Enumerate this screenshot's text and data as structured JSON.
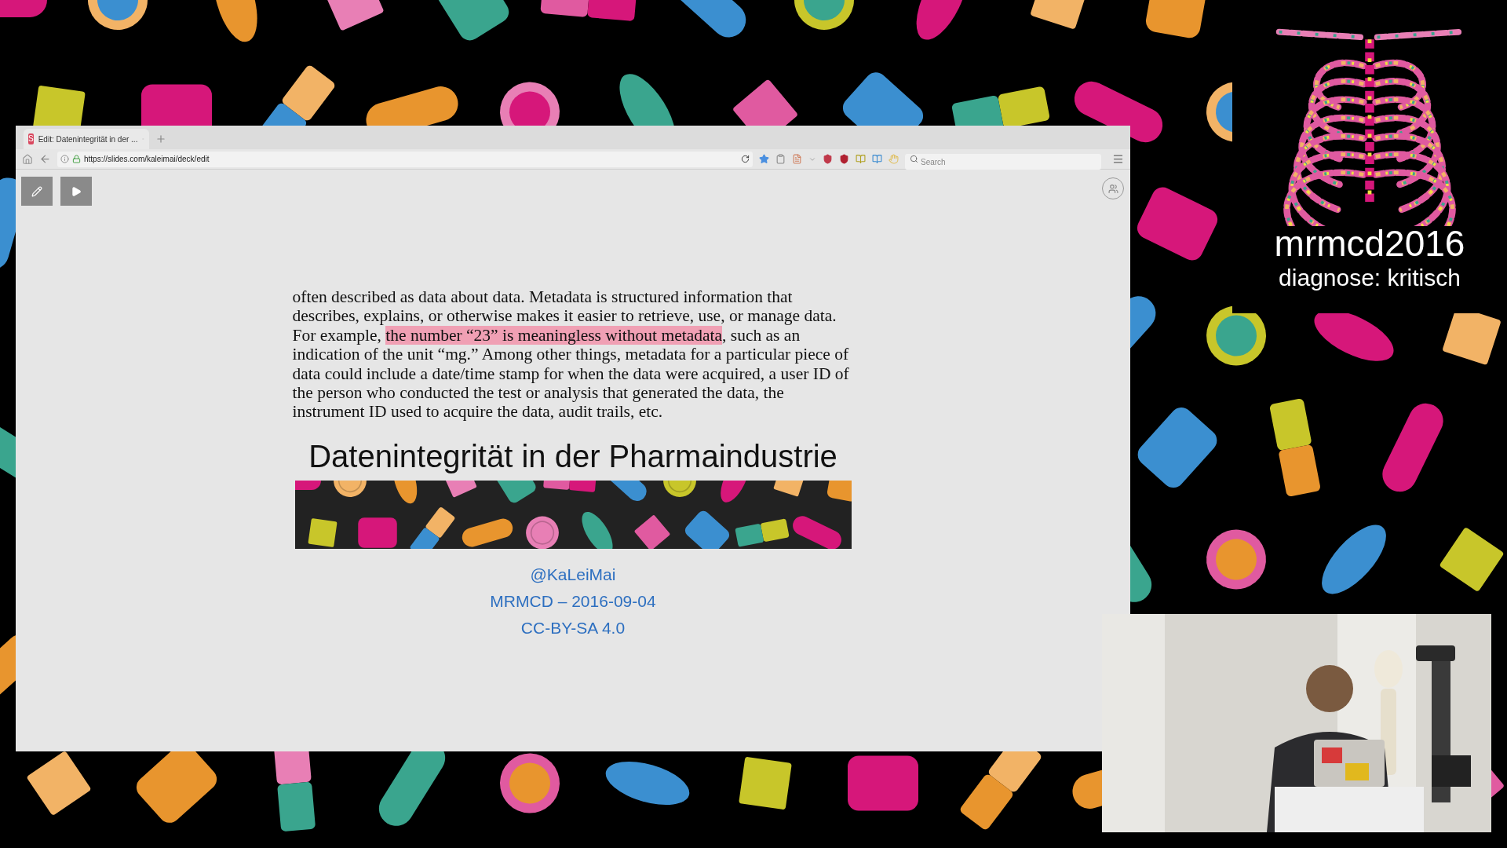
{
  "browser": {
    "tab": {
      "favicon": "S",
      "title": "Edit: Datenintegrität in der ..."
    },
    "url": "https://slides.com/kaleimai/deck/edit",
    "search": {
      "placeholder": "Search"
    }
  },
  "slide": {
    "paragraph": [
      {
        "text": "often described as data about data. Metadata is structured information that describes, explains, or otherwise makes it easier to retrieve, use, or manage data. For example, ",
        "highlighted": false
      },
      {
        "text": "the number “23” is meaningless without metadata",
        "highlighted": true
      },
      {
        "text": ", such as an indication of the unit “mg.” Among other things, metadata for a particular piece of data could include a date/time stamp for when the data were acquired, a user ID of the person who conducted the test or analysis that generated the data, the instrument ID used to acquire the data, audit trails, etc.",
        "highlighted": false
      }
    ],
    "title": "Datenintegrität in der Pharmaindustrie",
    "links": [
      "@KaLeiMai",
      "MRMCD – 2016-09-04",
      "CC-BY-SA 4.0"
    ]
  },
  "event_logo": {
    "name": "mrmcd2016",
    "tagline": "diagnose: kritisch"
  }
}
